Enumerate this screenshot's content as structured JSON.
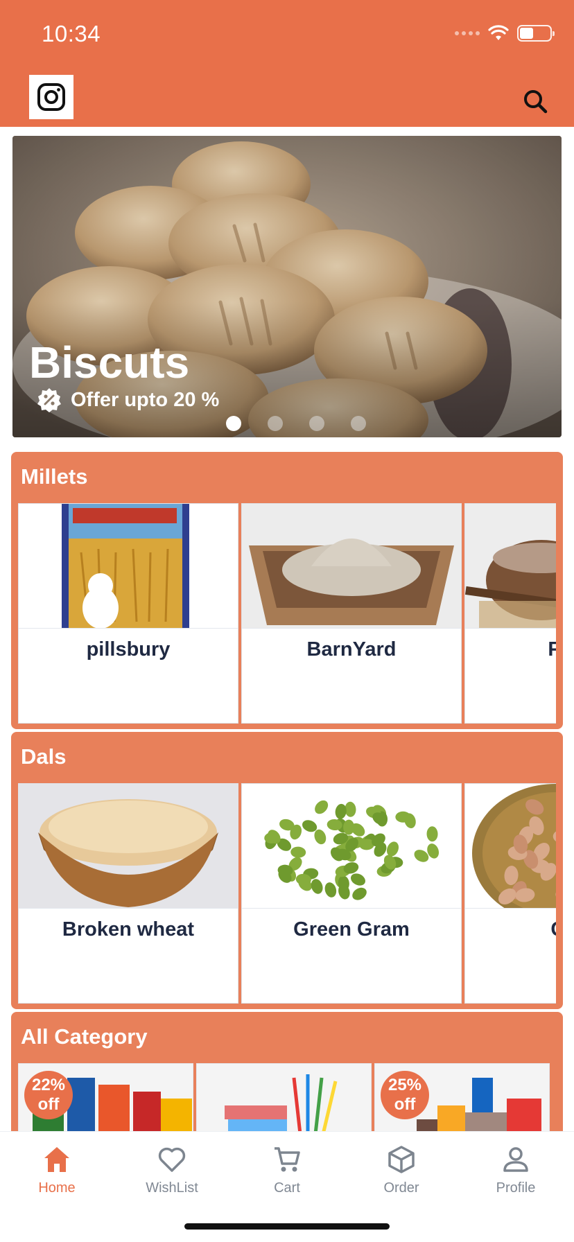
{
  "status_bar": {
    "time": "10:34",
    "battery_level": 0.45
  },
  "header": {
    "logo_icon": "instagram-icon",
    "search_icon": "search-icon"
  },
  "banner": {
    "title": "Biscuts",
    "offer": "Offer upto 20 %",
    "offer_icon": "discount-badge-icon",
    "slides": 4,
    "active_slide": 1
  },
  "sections": [
    {
      "title": "Millets",
      "items": [
        {
          "name": "pillsbury"
        },
        {
          "name": "BarnYard"
        },
        {
          "name": "Finge"
        }
      ]
    },
    {
      "title": "Dals",
      "items": [
        {
          "name": "Broken wheat"
        },
        {
          "name": "Green Gram"
        },
        {
          "name": "Grou"
        }
      ]
    }
  ],
  "all_category": {
    "title": "All Category",
    "items": [
      {
        "badge_percent": "22%",
        "badge_suffix": "off"
      },
      {
        "badge_percent": "",
        "badge_suffix": ""
      },
      {
        "badge_percent": "25%",
        "badge_suffix": "off"
      }
    ]
  },
  "bottom_nav": {
    "items": [
      {
        "label": "Home",
        "icon": "home-icon",
        "active": true
      },
      {
        "label": "WishList",
        "icon": "heart-icon",
        "active": false
      },
      {
        "label": "Cart",
        "icon": "cart-icon",
        "active": false
      },
      {
        "label": "Order",
        "icon": "box-icon",
        "active": false
      },
      {
        "label": "Profile",
        "icon": "person-icon",
        "active": false
      }
    ]
  },
  "colors": {
    "primary": "#E8704A",
    "section_bg": "#E8805A",
    "text_dark": "#1f2942",
    "nav_inactive": "#808893"
  }
}
